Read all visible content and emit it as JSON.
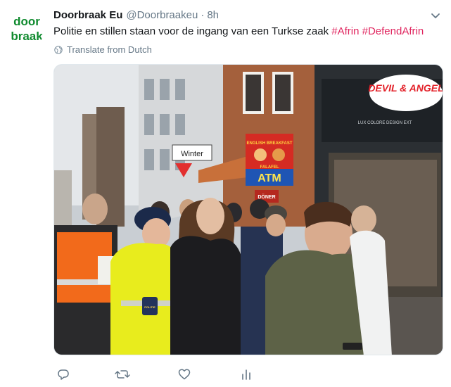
{
  "tweet": {
    "author_name": "Doorbraak Eu",
    "handle": "@Doorbraakeu",
    "separator": "·",
    "time": "8h",
    "text": "Politie en stillen staan voor de ingang van een Turkse zaak",
    "hashtags": [
      "#Afrin",
      "#DefendAfrin"
    ],
    "translate_label": "Translate from Dutch"
  },
  "avatar": {
    "logo_line1": "door",
    "logo_line2": "braak",
    "color": "#0f8a2e"
  },
  "photo_signs": {
    "street_sign": "Winter",
    "shop_sign": "DEVIL & ANGEL",
    "shop_sub": "LUX COLORE DESIGN EXT",
    "restaurant_line1": "ENGLISH BREAKFAST",
    "restaurant_line2": "FALAFEL",
    "atm": "ATM",
    "doner": "DÖNER",
    "police_patch": "POLITIE"
  },
  "icons": {
    "reply": "reply-icon",
    "retweet": "retweet-icon",
    "like": "heart-icon",
    "analytics": "analytics-icon",
    "caret": "chevron-down-icon",
    "globe": "globe-icon"
  },
  "colors": {
    "hashtag": "#e0245e",
    "secondary": "#657786",
    "brand_green": "#0f8a2e"
  }
}
